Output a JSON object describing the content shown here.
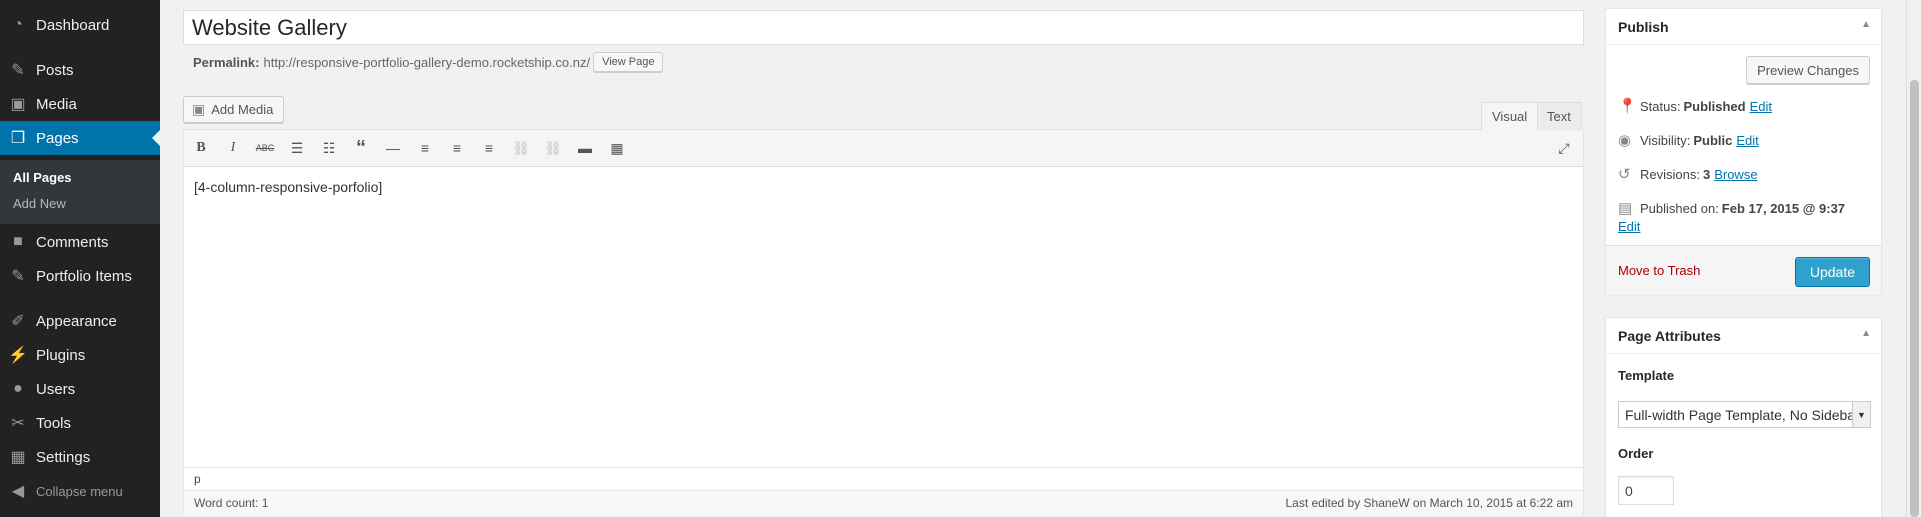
{
  "sidebar": {
    "items": [
      {
        "label": "Dashboard",
        "icon": "dashboard-icon"
      },
      {
        "label": "Posts",
        "icon": "pushpin-icon"
      },
      {
        "label": "Media",
        "icon": "media-icon"
      },
      {
        "label": "Pages",
        "icon": "pages-icon"
      },
      {
        "label": "Comments",
        "icon": "comment-icon"
      },
      {
        "label": "Portfolio Items",
        "icon": "pushpin-icon"
      },
      {
        "label": "Appearance",
        "icon": "brush-icon"
      },
      {
        "label": "Plugins",
        "icon": "plugin-icon"
      },
      {
        "label": "Users",
        "icon": "user-icon"
      },
      {
        "label": "Tools",
        "icon": "wrench-icon"
      },
      {
        "label": "Settings",
        "icon": "settings-icon"
      }
    ],
    "submenu": [
      "All Pages",
      "Add New"
    ],
    "collapse_label": "Collapse menu"
  },
  "editor": {
    "title": "Website Gallery",
    "permalink_label": "Permalink:",
    "permalink_url": "http://responsive-portfolio-gallery-demo.rocketship.co.nz/",
    "view_page_label": "View Page",
    "add_media_label": "Add Media",
    "tab_visual": "Visual",
    "tab_text": "Text",
    "content": "[4-column-responsive-porfolio]",
    "path": "p",
    "word_count": "Word count: 1",
    "last_edited": "Last edited by ShaneW on March 10, 2015 at 6:22 am"
  },
  "publish": {
    "title": "Publish",
    "preview_label": "Preview Changes",
    "status_label": "Status:",
    "status_value": "Published",
    "visibility_label": "Visibility:",
    "visibility_value": "Public",
    "revisions_label": "Revisions:",
    "revisions_value": "3",
    "browse_label": "Browse",
    "published_label": "Published on:",
    "published_value": "Feb 17, 2015 @ 9:37",
    "edit_label": "Edit",
    "trash_label": "Move to Trash",
    "update_label": "Update"
  },
  "attributes": {
    "title": "Page Attributes",
    "template_label": "Template",
    "template_value": "Full-width Page Template, No Sideba",
    "order_label": "Order",
    "order_value": "0"
  },
  "colors": {
    "sidebar_bg": "#222222",
    "accent": "#0073aa",
    "update_button": "#2ea2cc",
    "trash": "#aa0000"
  }
}
